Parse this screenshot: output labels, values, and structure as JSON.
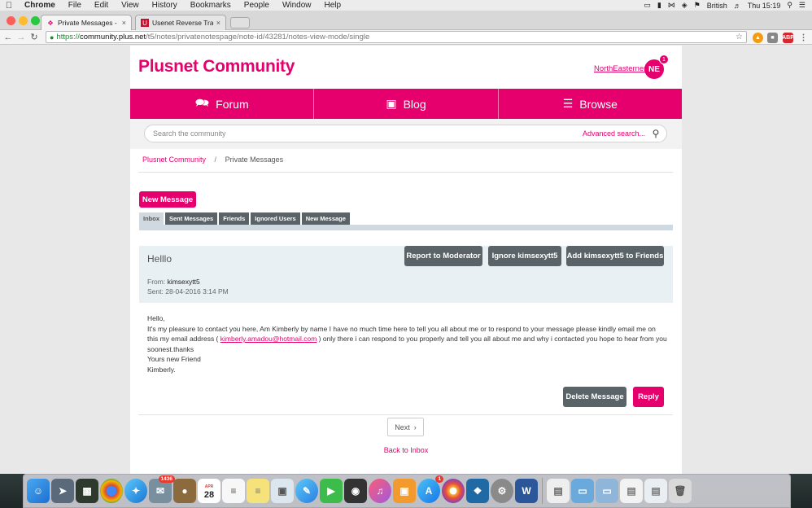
{
  "menubar": {
    "app": "Chrome",
    "items": [
      "File",
      "Edit",
      "View",
      "History",
      "Bookmarks",
      "People",
      "Window",
      "Help"
    ],
    "language": "British",
    "clock": "Thu 15:19"
  },
  "browser": {
    "tabs": [
      {
        "title": "Private Messages - Plusne"
      },
      {
        "title": "Usenet Reverse Traceroute"
      }
    ],
    "url": {
      "scheme": "https://",
      "host": "community.plus.net",
      "path": "/t5/notes/privatenotespage/note-id/43281/notes-view-mode/single"
    },
    "ext_abp": "ABP"
  },
  "site": {
    "brand": "Plusnet Community",
    "username": "NorthEasterner",
    "avatar_initials": "NE",
    "notification_count": "1",
    "nav": [
      {
        "label": "Forum",
        "icon": "chat-bubbles-icon"
      },
      {
        "label": "Blog",
        "icon": "speech-bubble-icon"
      },
      {
        "label": "Browse",
        "icon": "hamburger-icon"
      }
    ],
    "search_placeholder": "Search the community",
    "advanced_search": "Advanced search...",
    "breadcrumb": [
      "Plusnet Community",
      "Private Messages"
    ],
    "breadcrumb_sep": "/",
    "accent_color": "#e5006d"
  },
  "messages": {
    "new_message_button": "New Message",
    "tabs": [
      "Inbox",
      "Sent Messages",
      "Friends",
      "Ignored Users",
      "New Message"
    ],
    "active_tab": "Inbox",
    "subject": "Helllo",
    "from_label": "From:",
    "from_user": "kimsexytt5",
    "sent_label": "Sent:",
    "sent_value": "28-04-2016 3:14 PM",
    "actions": [
      "Report to Moderator",
      "Ignore kimsexytt5",
      "Add kimsexytt5 to Friends"
    ],
    "body": {
      "greeting": "Hello,",
      "para1": "It's my pleasure to contact you here, Am Kimberly by name I have no much time here to tell you all about me or to respond to your message please kindly email me on this my email address ( ",
      "email": "kimberly.amadou@hotmail.com",
      "para1_tail": " ) only there i can respond to you properly and tell you all about me and why i contacted you hope to hear from you soonest.thanks",
      "closing": "Yours new Friend",
      "signature": "Kimberly."
    },
    "delete_button": "Delete Message",
    "reply_button": "Reply",
    "next_button": "Next",
    "back_link": "Back to Inbox"
  },
  "dock": {
    "mail_badge": "1436",
    "calendar_month": "APR",
    "calendar_day": "28",
    "appstore_badge": "1"
  }
}
